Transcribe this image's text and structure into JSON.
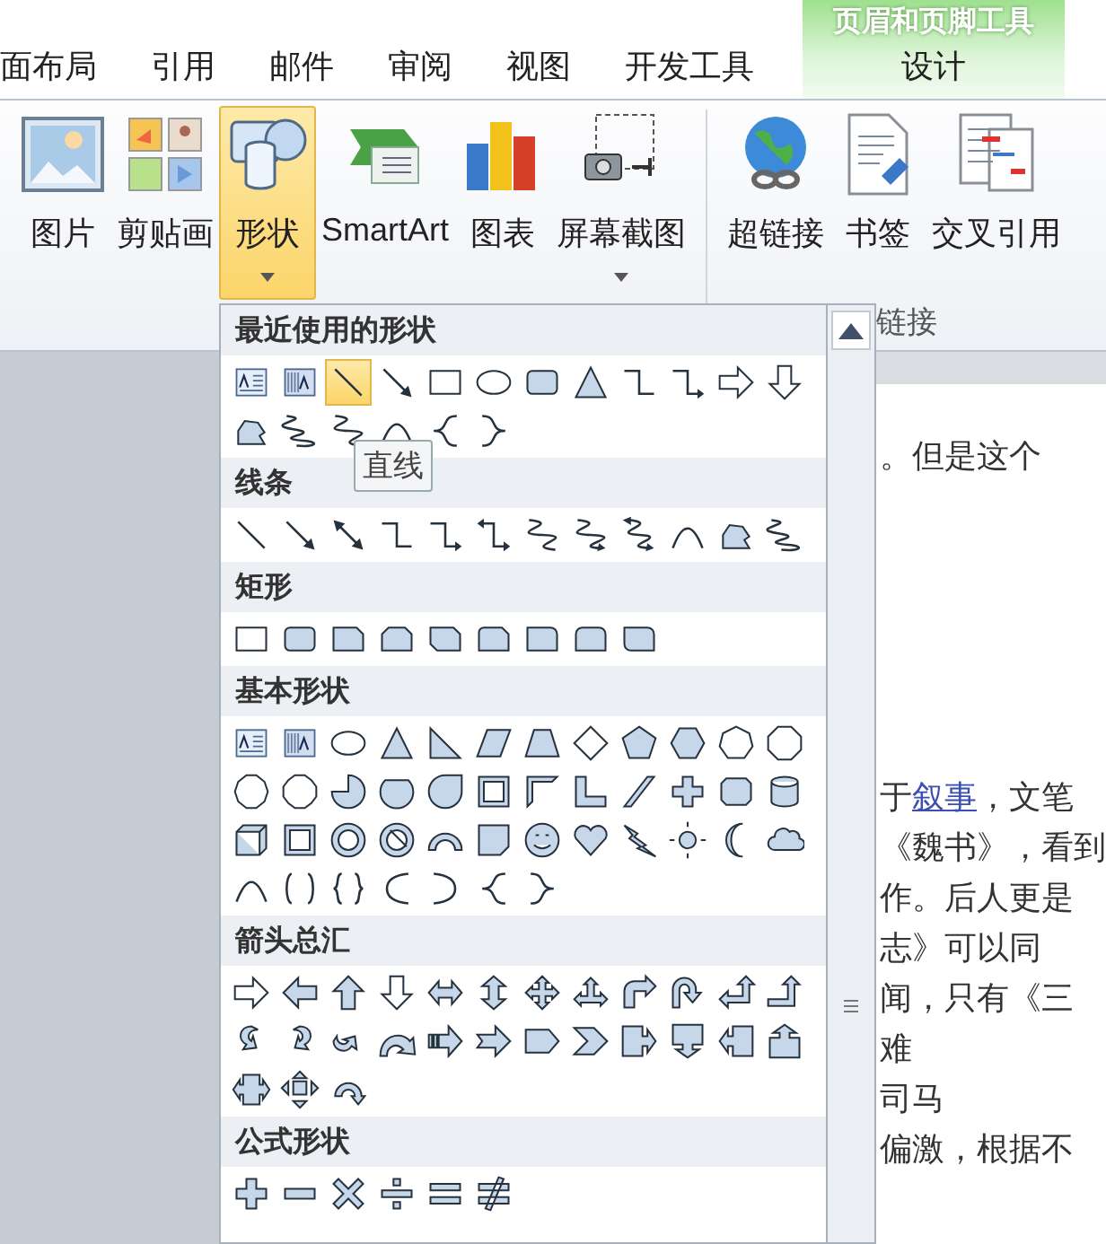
{
  "ribbon": {
    "tabs": [
      {
        "label": "面布局",
        "selected": false
      },
      {
        "label": "引用",
        "selected": false
      },
      {
        "label": "邮件",
        "selected": false
      },
      {
        "label": "审阅",
        "selected": false
      },
      {
        "label": "视图",
        "selected": false
      },
      {
        "label": "开发工具",
        "selected": false
      }
    ],
    "contextual": {
      "title": "页眉和页脚工具",
      "tab": {
        "label": "设计",
        "selected": false
      }
    },
    "buttons": [
      {
        "kind": "picture",
        "label": "图片",
        "dropdown": false,
        "selected": false
      },
      {
        "kind": "clipart",
        "label": "剪贴画",
        "dropdown": false,
        "selected": false
      },
      {
        "kind": "shapes",
        "label": "形状",
        "dropdown": true,
        "selected": true
      },
      {
        "kind": "smartart",
        "label": "SmartArt",
        "dropdown": false,
        "selected": false
      },
      {
        "kind": "chart",
        "label": "图表",
        "dropdown": false,
        "selected": false
      },
      {
        "kind": "screenshot",
        "label": "屏幕截图",
        "dropdown": true,
        "selected": false
      },
      {
        "kind": "hyperlink",
        "label": "超链接",
        "dropdown": false,
        "selected": false
      },
      {
        "kind": "bookmark",
        "label": "书签",
        "dropdown": false,
        "selected": false
      },
      {
        "kind": "crossref",
        "label": "交叉引用",
        "dropdown": false,
        "selected": false
      }
    ],
    "group_label": "链接"
  },
  "gallery": {
    "tooltip": "直线",
    "sections": [
      {
        "title": "最近使用的形状",
        "shapes": [
          {
            "kind": "textbox",
            "selected": false
          },
          {
            "kind": "vtextbox",
            "selected": false
          },
          {
            "kind": "line",
            "selected": true
          },
          {
            "kind": "arrow",
            "selected": false
          },
          {
            "kind": "rect",
            "selected": false
          },
          {
            "kind": "ellipse",
            "selected": false
          },
          {
            "kind": "rrect",
            "selected": false
          },
          {
            "kind": "triangle",
            "selected": false
          },
          {
            "kind": "elbow",
            "selected": false
          },
          {
            "kind": "elbowarrow",
            "selected": false
          },
          {
            "kind": "arrow-r",
            "selected": false
          },
          {
            "kind": "arrow-d",
            "selected": false
          },
          {
            "kind": "freeform",
            "selected": false
          },
          {
            "kind": "scribble",
            "selected": false
          },
          {
            "kind": "curve",
            "selected": false
          },
          {
            "kind": "arc",
            "selected": false
          },
          {
            "kind": "brace-l",
            "selected": false
          },
          {
            "kind": "brace-r",
            "selected": false
          }
        ]
      },
      {
        "title": "线条",
        "shapes": [
          {
            "kind": "line",
            "selected": false
          },
          {
            "kind": "arrow",
            "selected": false
          },
          {
            "kind": "dblarrow",
            "selected": false
          },
          {
            "kind": "elbow",
            "selected": false
          },
          {
            "kind": "elbowarrow",
            "selected": false
          },
          {
            "kind": "elbowdbl",
            "selected": false
          },
          {
            "kind": "curve",
            "selected": false
          },
          {
            "kind": "curvearrow",
            "selected": false
          },
          {
            "kind": "curvedbl",
            "selected": false
          },
          {
            "kind": "arc",
            "selected": false
          },
          {
            "kind": "freeform",
            "selected": false
          },
          {
            "kind": "scribble",
            "selected": false
          }
        ]
      },
      {
        "title": "矩形",
        "shapes": [
          {
            "kind": "rect",
            "selected": false
          },
          {
            "kind": "rrect",
            "selected": false
          },
          {
            "kind": "snip1",
            "selected": false
          },
          {
            "kind": "snip2",
            "selected": false
          },
          {
            "kind": "snipd",
            "selected": false
          },
          {
            "kind": "snipround",
            "selected": false
          },
          {
            "kind": "round1",
            "selected": false
          },
          {
            "kind": "round2",
            "selected": false
          },
          {
            "kind": "roundd",
            "selected": false
          }
        ]
      },
      {
        "title": "基本形状",
        "shapes": [
          {
            "kind": "textbox",
            "selected": false
          },
          {
            "kind": "vtextbox",
            "selected": false
          },
          {
            "kind": "ellipse",
            "selected": false
          },
          {
            "kind": "triangle",
            "selected": false
          },
          {
            "kind": "rtriangle",
            "selected": false
          },
          {
            "kind": "parallelogram",
            "selected": false
          },
          {
            "kind": "trapezoid",
            "selected": false
          },
          {
            "kind": "diamond",
            "selected": false
          },
          {
            "kind": "pentagon",
            "selected": false
          },
          {
            "kind": "hexagon",
            "selected": false
          },
          {
            "kind": "heptagon",
            "selected": false
          },
          {
            "kind": "octagon",
            "selected": false
          },
          {
            "kind": "decagon",
            "selected": false
          },
          {
            "kind": "dodecagon",
            "selected": false
          },
          {
            "kind": "pie",
            "selected": false
          },
          {
            "kind": "chord",
            "selected": false
          },
          {
            "kind": "teardrop",
            "selected": false
          },
          {
            "kind": "frame",
            "selected": false
          },
          {
            "kind": "halfframe",
            "selected": false
          },
          {
            "kind": "lshape",
            "selected": false
          },
          {
            "kind": "diagstripe",
            "selected": false
          },
          {
            "kind": "cross",
            "selected": false
          },
          {
            "kind": "plaque",
            "selected": false
          },
          {
            "kind": "can",
            "selected": false
          },
          {
            "kind": "cube",
            "selected": false
          },
          {
            "kind": "bevel",
            "selected": false
          },
          {
            "kind": "donut",
            "selected": false
          },
          {
            "kind": "nosymbol",
            "selected": false
          },
          {
            "kind": "blockarc",
            "selected": false
          },
          {
            "kind": "folded",
            "selected": false
          },
          {
            "kind": "smiley",
            "selected": false
          },
          {
            "kind": "heart",
            "selected": false
          },
          {
            "kind": "lightning",
            "selected": false
          },
          {
            "kind": "sun",
            "selected": false
          },
          {
            "kind": "moon",
            "selected": false
          },
          {
            "kind": "cloud",
            "selected": false
          },
          {
            "kind": "arc",
            "selected": false
          },
          {
            "kind": "bracketpair",
            "selected": false
          },
          {
            "kind": "bracepair",
            "selected": false
          },
          {
            "kind": "bracket-l",
            "selected": false
          },
          {
            "kind": "bracket-r",
            "selected": false
          },
          {
            "kind": "brace-l",
            "selected": false
          },
          {
            "kind": "brace-r",
            "selected": false
          }
        ]
      },
      {
        "title": "箭头总汇",
        "shapes": [
          {
            "kind": "arrow-r",
            "selected": false
          },
          {
            "kind": "arrow-l",
            "selected": false
          },
          {
            "kind": "arrow-u",
            "selected": false
          },
          {
            "kind": "arrow-d",
            "selected": false
          },
          {
            "kind": "arrow-lr",
            "selected": false
          },
          {
            "kind": "arrow-ud",
            "selected": false
          },
          {
            "kind": "arrow-quad",
            "selected": false
          },
          {
            "kind": "arrow-lru",
            "selected": false
          },
          {
            "kind": "bent",
            "selected": false
          },
          {
            "kind": "uturn",
            "selected": false
          },
          {
            "kind": "leftup",
            "selected": false
          },
          {
            "kind": "bentup",
            "selected": false
          },
          {
            "kind": "curved-r",
            "selected": false
          },
          {
            "kind": "curved-l",
            "selected": false
          },
          {
            "kind": "curved-u",
            "selected": false
          },
          {
            "kind": "curved-d",
            "selected": false
          },
          {
            "kind": "striped",
            "selected": false
          },
          {
            "kind": "notched",
            "selected": false
          },
          {
            "kind": "homeplate",
            "selected": false
          },
          {
            "kind": "chevron",
            "selected": false
          },
          {
            "kind": "callout-r",
            "selected": false
          },
          {
            "kind": "callout-d",
            "selected": false
          },
          {
            "kind": "callout-l",
            "selected": false
          },
          {
            "kind": "callout-u",
            "selected": false
          },
          {
            "kind": "callout-lr",
            "selected": false
          },
          {
            "kind": "callout-quad",
            "selected": false
          },
          {
            "kind": "circular",
            "selected": false
          }
        ]
      },
      {
        "title": "公式形状",
        "shapes": [
          {
            "kind": "plus",
            "selected": false
          },
          {
            "kind": "minus",
            "selected": false
          },
          {
            "kind": "multiply",
            "selected": false
          },
          {
            "kind": "divide",
            "selected": false
          },
          {
            "kind": "equal",
            "selected": false
          },
          {
            "kind": "notequal",
            "selected": false
          }
        ]
      }
    ]
  },
  "document": {
    "blocks": [
      [
        "。但是这个"
      ],
      [
        "于**叙事**，文笔",
        "《魏书》，看到",
        "作。后人更是",
        "志》可以同",
        "闻，只有《三",
        "难",
        "司马",
        "偏激，根据不"
      ]
    ]
  }
}
